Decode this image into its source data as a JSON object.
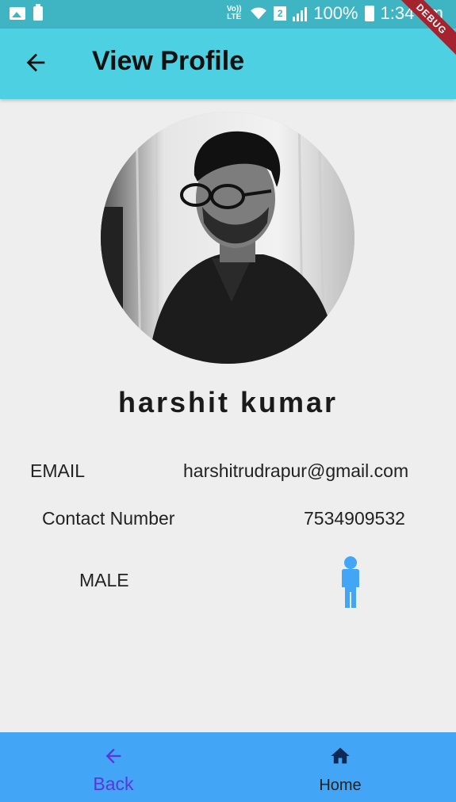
{
  "status_bar": {
    "volte": "Vo)) LTE",
    "sim": "2",
    "battery": "100%",
    "time": "1:34 am"
  },
  "debug_banner": "DEBUG",
  "appbar": {
    "title": "View Profile",
    "back_icon": "arrow-back-icon"
  },
  "profile": {
    "name": "harshit kumar",
    "email_label": "EMAIL",
    "email_value": "harshitrudrapur@gmail.com",
    "contact_label": "Contact Number",
    "contact_value": "7534909532",
    "gender_label": "MALE",
    "gender_icon": "male-person-icon",
    "gender_icon_color": "#42a5f5"
  },
  "bottom_nav": {
    "back_label": "Back",
    "home_label": "Home",
    "back_color": "#5e35d8"
  },
  "colors": {
    "appbar": "#4dd0e1",
    "bottom_nav": "#42a5f5",
    "background": "#eeeeee"
  }
}
